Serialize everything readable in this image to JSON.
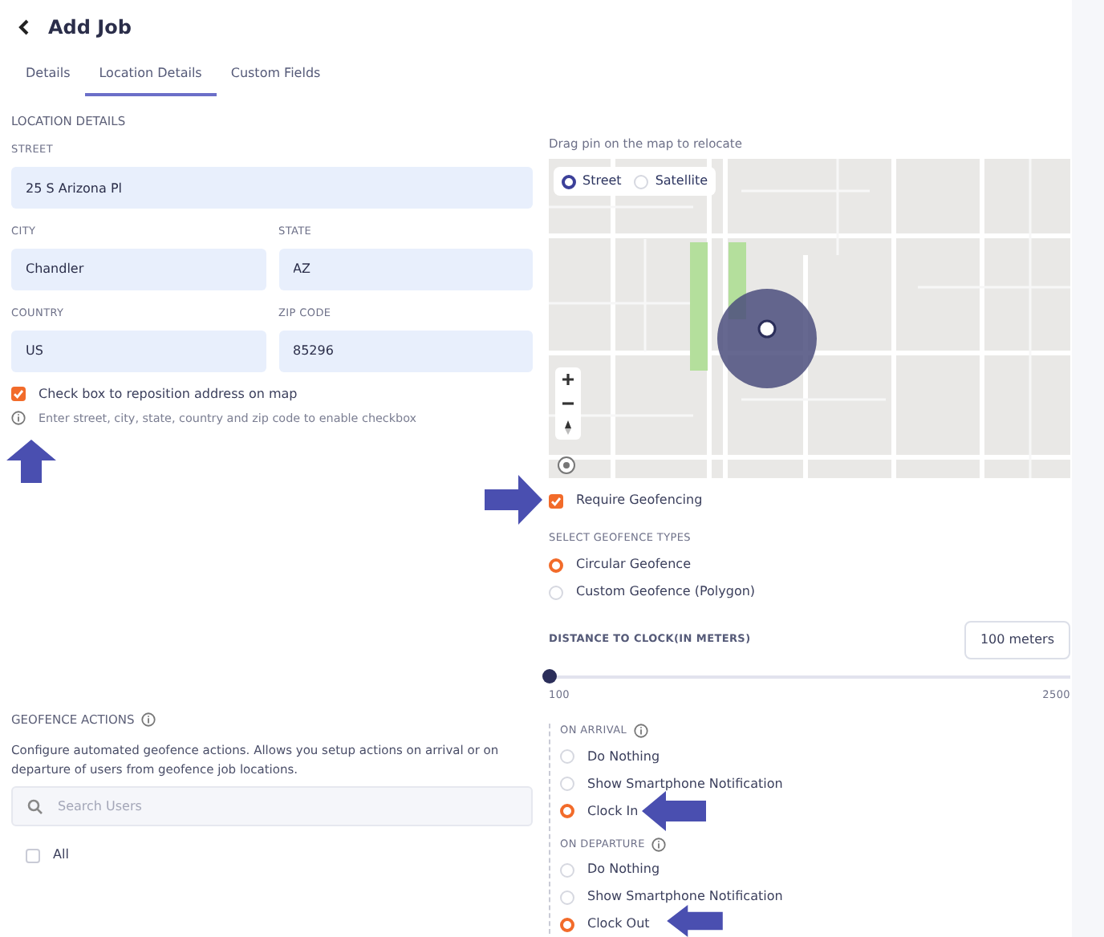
{
  "header": {
    "title": "Add Job"
  },
  "tabs": [
    {
      "label": "Details",
      "selected": false
    },
    {
      "label": "Location Details",
      "selected": true
    },
    {
      "label": "Custom Fields",
      "selected": false
    }
  ],
  "location": {
    "heading": "LOCATION DETAILS",
    "fields": [
      {
        "label": "STREET",
        "value": "25 S Arizona Pl"
      },
      {
        "label": "CITY",
        "value": "Chandler"
      },
      {
        "label": "STATE",
        "value": "AZ"
      },
      {
        "label": "COUNTRY",
        "value": "US"
      },
      {
        "label": "ZIP CODE",
        "value": "85296"
      }
    ],
    "reposition": {
      "label": "Check box to reposition address on map",
      "checked": true
    },
    "hint": "Enter street, city, state, country and zip code to enable checkbox"
  },
  "map": {
    "caption": "Drag pin on the map to relocate",
    "view_options": [
      {
        "label": "Street",
        "selected": true
      },
      {
        "label": "Satellite",
        "selected": false
      }
    ]
  },
  "geofencing": {
    "label": "Require Geofencing",
    "checked": true
  },
  "geofence_types": {
    "heading": "SELECT GEOFENCE TYPES",
    "options": [
      {
        "label": "Circular Geofence",
        "selected": true
      },
      {
        "label": "Custom Geofence (Polygon)",
        "selected": false
      }
    ]
  },
  "distance": {
    "label": "DISTANCE TO CLOCK(IN METERS)",
    "value": "100 meters",
    "level": 0,
    "min": "100",
    "max": "2500"
  },
  "actions": {
    "heading": "GEOFENCE ACTIONS",
    "description": "Configure automated geofence actions. Allows you setup actions on arrival or on departure of users from geofence job locations.",
    "search": {
      "placeholder": "Search Users"
    },
    "all": {
      "label": "All",
      "checked": false
    }
  },
  "on_arrival": {
    "heading": "ON ARRIVAL",
    "options": [
      {
        "label": "Do Nothing",
        "selected": false
      },
      {
        "label": "Show Smartphone Notification",
        "selected": false
      },
      {
        "label": "Clock In",
        "selected": true
      }
    ]
  },
  "on_departure": {
    "heading": "ON DEPARTURE",
    "options": [
      {
        "label": "Do Nothing",
        "selected": false
      },
      {
        "label": "Show Smartphone Notification",
        "selected": false
      },
      {
        "label": "Clock Out",
        "selected": true
      }
    ]
  }
}
